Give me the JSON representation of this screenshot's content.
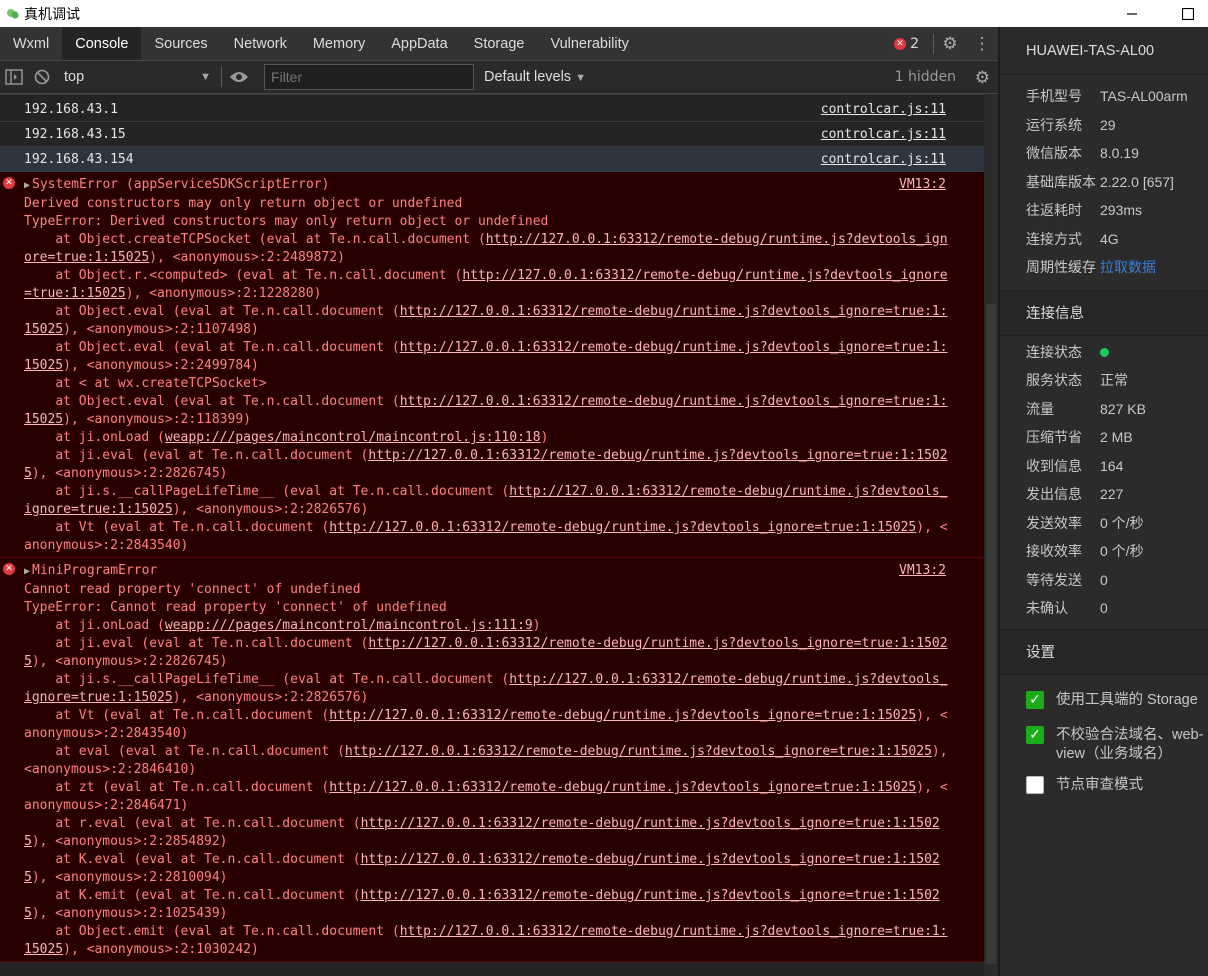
{
  "window": {
    "title": "真机调试",
    "minimize_icon": "minimize-icon",
    "maximize_icon": "maximize-icon"
  },
  "tabs": [
    {
      "label": "Wxml"
    },
    {
      "label": "Console",
      "active": true
    },
    {
      "label": "Sources"
    },
    {
      "label": "Network"
    },
    {
      "label": "Memory"
    },
    {
      "label": "AppData"
    },
    {
      "label": "Storage"
    },
    {
      "label": "Vulnerability"
    }
  ],
  "error_count": "2",
  "toolbar": {
    "context": "top",
    "filter_placeholder": "Filter",
    "levels": "Default levels",
    "hidden": "1 hidden"
  },
  "logs": [
    {
      "text": "192.168.43.1",
      "source": "controlcar.js:11"
    },
    {
      "text": "192.168.43.15",
      "source": "controlcar.js:11"
    },
    {
      "text": "192.168.43.154",
      "source": "controlcar.js:11"
    }
  ],
  "errors": [
    {
      "title": "SystemError (appServiceSDKScriptError)",
      "source": "VM13:2",
      "lines": [
        "Derived constructors may only return object or undefined",
        "TypeError: Derived constructors may only return object or undefined",
        "    at Object.createTCPSocket (eval at Te.n.call.document (|http://127.0.0.1:63312/remote-debug/runtime.js?devtools_ignore=true:1:15025|), <anonymous>:2:2489872)",
        "    at Object.r.<computed> (eval at Te.n.call.document (|http://127.0.0.1:63312/remote-debug/runtime.js?devtools_ignore=true:1:15025|), <anonymous>:2:1228280)",
        "    at Object.eval (eval at Te.n.call.document (|http://127.0.0.1:63312/remote-debug/runtime.js?devtools_ignore=true:1:15025|), <anonymous>:2:1107498)",
        "    at Object.eval (eval at Te.n.call.document (|http://127.0.0.1:63312/remote-debug/runtime.js?devtools_ignore=true:1:15025|), <anonymous>:2:2499784)",
        "    at < at wx.createTCPSocket>",
        "    at Object.eval (eval at Te.n.call.document (|http://127.0.0.1:63312/remote-debug/runtime.js?devtools_ignore=true:1:15025|), <anonymous>:2:118399)",
        "    at ji.onLoad (|weapp:///pages/maincontrol/maincontrol.js:110:18|)",
        "    at ji.eval (eval at Te.n.call.document (|http://127.0.0.1:63312/remote-debug/runtime.js?devtools_ignore=true:1:15025|), <anonymous>:2:2826745)",
        "    at ji.s.__callPageLifeTime__ (eval at Te.n.call.document (|http://127.0.0.1:63312/remote-debug/runtime.js?devtools_ignore=true:1:15025|), <anonymous>:2:2826576)",
        "    at Vt (eval at Te.n.call.document (|http://127.0.0.1:63312/remote-debug/runtime.js?devtools_ignore=true:1:15025|), <anonymous>:2:2843540)"
      ]
    },
    {
      "title": "MiniProgramError",
      "source": "VM13:2",
      "lines": [
        "Cannot read property 'connect' of undefined",
        "TypeError: Cannot read property 'connect' of undefined",
        "    at ji.onLoad (|weapp:///pages/maincontrol/maincontrol.js:111:9|)",
        "    at ji.eval (eval at Te.n.call.document (|http://127.0.0.1:63312/remote-debug/runtime.js?devtools_ignore=true:1:15025|), <anonymous>:2:2826745)",
        "    at ji.s.__callPageLifeTime__ (eval at Te.n.call.document (|http://127.0.0.1:63312/remote-debug/runtime.js?devtools_ignore=true:1:15025|), <anonymous>:2:2826576)",
        "    at Vt (eval at Te.n.call.document (|http://127.0.0.1:63312/remote-debug/runtime.js?devtools_ignore=true:1:15025|), <anonymous>:2:2843540)",
        "    at eval (eval at Te.n.call.document (|http://127.0.0.1:63312/remote-debug/runtime.js?devtools_ignore=true:1:15025|), <anonymous>:2:2846410)",
        "    at zt (eval at Te.n.call.document (|http://127.0.0.1:63312/remote-debug/runtime.js?devtools_ignore=true:1:15025|), <anonymous>:2:2846471)",
        "    at r.eval (eval at Te.n.call.document (|http://127.0.0.1:63312/remote-debug/runtime.js?devtools_ignore=true:1:15025|), <anonymous>:2:2854892)",
        "    at K.eval (eval at Te.n.call.document (|http://127.0.0.1:63312/remote-debug/runtime.js?devtools_ignore=true:1:15025|), <anonymous>:2:2810094)",
        "    at K.emit (eval at Te.n.call.document (|http://127.0.0.1:63312/remote-debug/runtime.js?devtools_ignore=true:1:15025|), <anonymous>:2:1025439)",
        "    at Object.emit (eval at Te.n.call.document (|http://127.0.0.1:63312/remote-debug/runtime.js?devtools_ignore=true:1:15025|), <anonymous>:2:1030242)"
      ]
    }
  ],
  "panel": {
    "device": "HUAWEI-TAS-AL00",
    "info": [
      {
        "k": "手机型号",
        "v": "TAS-AL00arm"
      },
      {
        "k": "运行系统",
        "v": "29"
      },
      {
        "k": "微信版本",
        "v": "8.0.19"
      },
      {
        "k": "基础库版本",
        "v": "2.22.0 [657]"
      },
      {
        "k": "往返耗时",
        "v": "293ms"
      },
      {
        "k": "连接方式",
        "v": "4G"
      },
      {
        "k": "周期性缓存",
        "v": "拉取数据",
        "link": true
      }
    ],
    "conn_title": "连接信息",
    "conn": [
      {
        "k": "连接状态",
        "v": "",
        "dot": true
      },
      {
        "k": "服务状态",
        "v": "正常"
      },
      {
        "k": "流量",
        "v": "827 KB"
      },
      {
        "k": "压缩节省",
        "v": "2 MB"
      },
      {
        "k": "收到信息",
        "v": "164"
      },
      {
        "k": "发出信息",
        "v": "227"
      },
      {
        "k": "发送效率",
        "v": "0 个/秒"
      },
      {
        "k": "接收效率",
        "v": "0 个/秒"
      },
      {
        "k": "等待发送",
        "v": "0"
      },
      {
        "k": "未确认",
        "v": "0"
      }
    ],
    "settings_title": "设置",
    "settings": [
      {
        "label": "使用工具端的 Storage",
        "checked": true
      },
      {
        "label": "不校验合法域名、web-view（业务域名）",
        "checked": true
      },
      {
        "label": "节点审查模式",
        "checked": false
      }
    ]
  },
  "colors": {
    "error_bg": "#290000",
    "error_text": "#ff8080",
    "status_green": "#1ec75b",
    "checkbox_green": "#1aad19",
    "link_blue": "#3b7dd8"
  }
}
